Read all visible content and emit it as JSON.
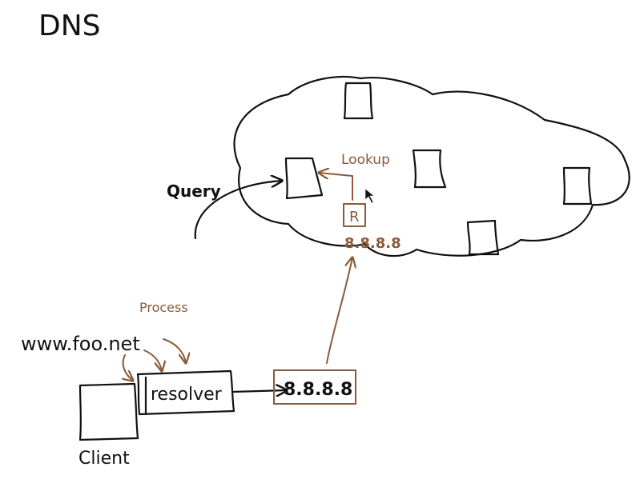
{
  "title": "DNS",
  "labels": {
    "query": "Query",
    "lookup": "Lookup",
    "process": "Process",
    "domain": "www.foo.net",
    "resolver": "resolver",
    "client": "Client",
    "resolver_ip": "8.8.8.8",
    "cloud_ip": "8.8.8.8",
    "resolver_server_letter": "R"
  },
  "colors": {
    "ink": "#111111",
    "annotation": "#8a5a3a"
  }
}
